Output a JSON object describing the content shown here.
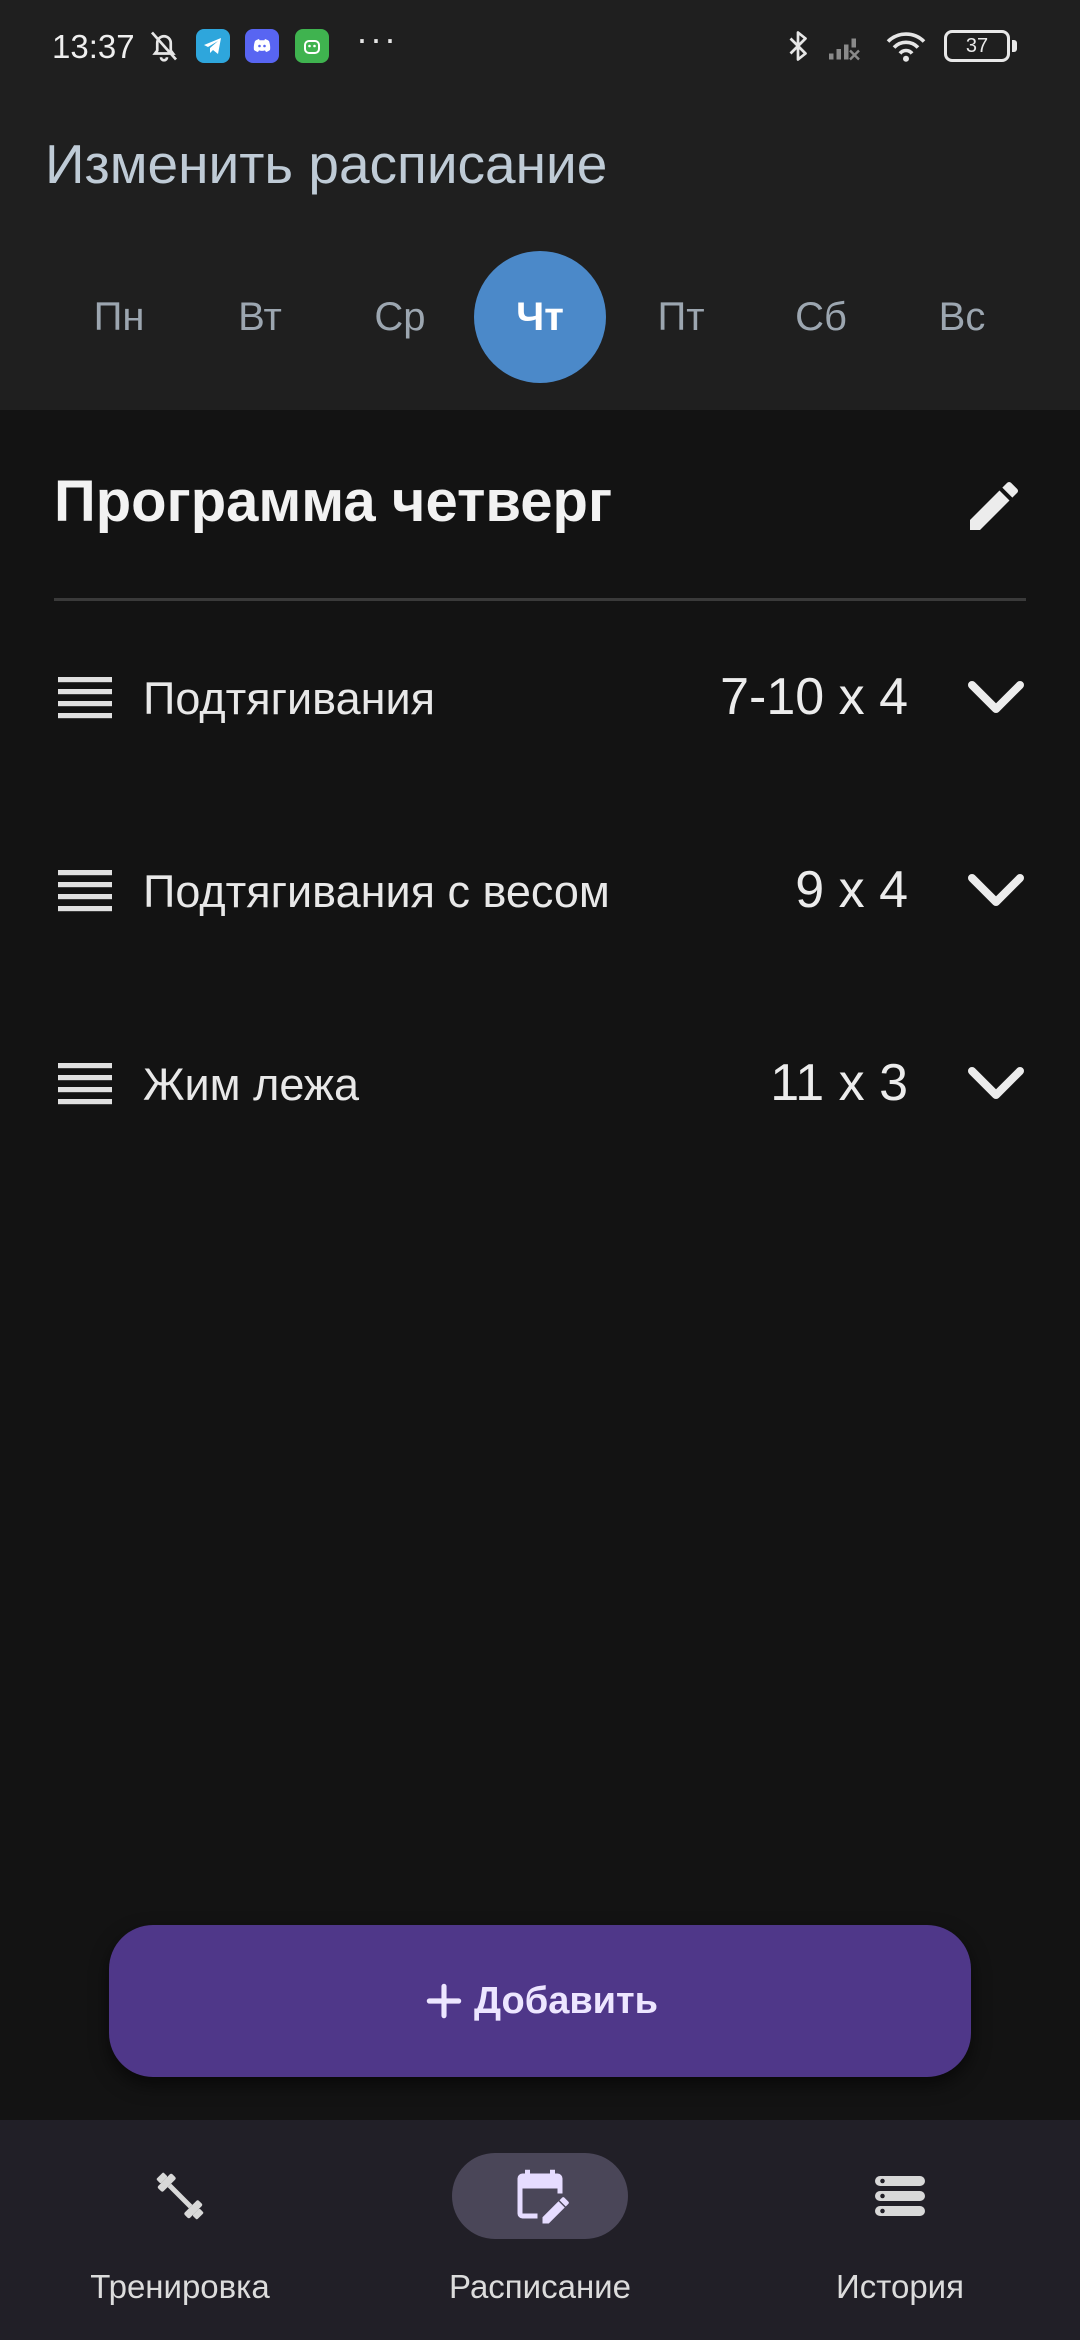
{
  "status_bar": {
    "time": "13:37",
    "battery": "37",
    "icons": [
      "bell-off-icon",
      "telegram-icon",
      "discord-icon",
      "android-app-icon",
      "more-dots-icon",
      "bluetooth-icon",
      "signal-icon",
      "wifi-icon",
      "battery-icon"
    ]
  },
  "header": {
    "title": "Изменить расписание"
  },
  "days": [
    {
      "label": "Пн",
      "selected": false
    },
    {
      "label": "Вт",
      "selected": false
    },
    {
      "label": "Ср",
      "selected": false
    },
    {
      "label": "Чт",
      "selected": true
    },
    {
      "label": "Пт",
      "selected": false
    },
    {
      "label": "Сб",
      "selected": false
    },
    {
      "label": "Вс",
      "selected": false
    }
  ],
  "program": {
    "title": "Программа четверг",
    "edit_icon": "pencil-icon"
  },
  "exercises": [
    {
      "name": "Подтягивания",
      "sets": "7-10 x 4"
    },
    {
      "name": "Подтягивания с весом",
      "sets": "9 x 4"
    },
    {
      "name": "Жим лежа",
      "sets": "11 x 3"
    }
  ],
  "add_button": {
    "label": "Добавить",
    "icon": "plus-icon"
  },
  "nav": [
    {
      "label": "Тренировка",
      "icon": "dumbbell-icon",
      "active": false
    },
    {
      "label": "Расписание",
      "icon": "calendar-edit-icon",
      "active": true
    },
    {
      "label": "История",
      "icon": "list-icon",
      "active": false
    }
  ],
  "colors": {
    "accent_day": "#4b89c9",
    "add_button": "#4f3789",
    "background": "#131313",
    "panel": "#1f1f1f"
  }
}
